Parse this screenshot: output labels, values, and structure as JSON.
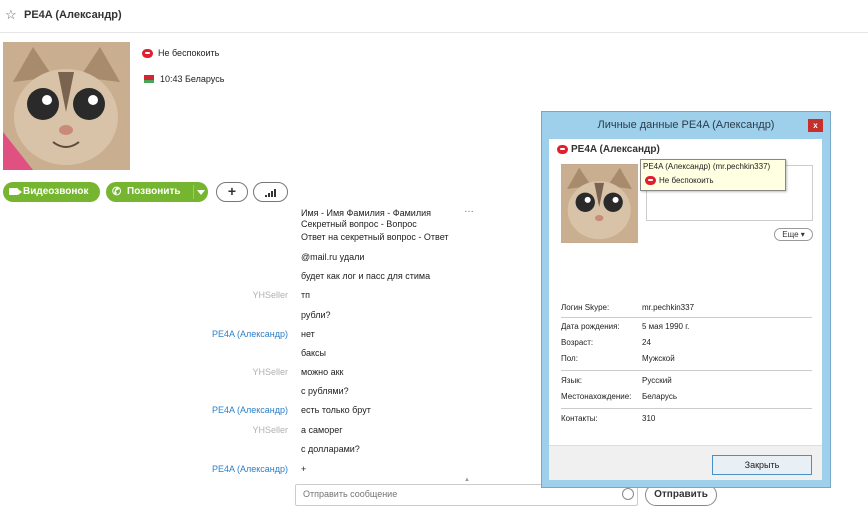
{
  "header": {
    "contact_name": "PE4A (Александр)"
  },
  "profile": {
    "status": "Не беспокоить",
    "local_time": "10:43 Беларусь"
  },
  "actions": {
    "video_call": "Видеозвонок",
    "call": "Позвонить",
    "add": "+"
  },
  "chat": {
    "top_cut_line": "Имя - Имя Фамилия - Фамилия",
    "messages": [
      {
        "sender": "",
        "text": "Секретный вопрос - Вопрос"
      },
      {
        "sender": "",
        "text": "Ответ на секретный вопрос - Ответ"
      },
      {
        "sender": "",
        "text": "@mail.ru удали"
      },
      {
        "sender": "",
        "text": "будет как лог и пасс для стима"
      },
      {
        "sender": "YHSeller",
        "text": "тп"
      },
      {
        "sender": "",
        "text": "рубли?"
      },
      {
        "sender": "PE4A (Александр)",
        "text": "нет"
      },
      {
        "sender": "",
        "text": "баксы"
      },
      {
        "sender": "YHSeller",
        "text": "можно акк"
      },
      {
        "sender": "",
        "text": "с рублями?"
      },
      {
        "sender": "PE4A (Александр)",
        "text": "есть только брут"
      },
      {
        "sender": "YHSeller",
        "text": "а саморег"
      },
      {
        "sender": "",
        "text": "с долларами?"
      },
      {
        "sender": "PE4A (Александр)",
        "text": "+"
      }
    ],
    "input_placeholder": "Отправить сообщение",
    "send_label": "Отправить"
  },
  "dialog": {
    "title": "Личные данные PE4A (Александр)",
    "name": "PE4A (Александр)",
    "tooltip": {
      "line1": "PE4A (Александр) (mr.pechkin337)",
      "line2": "Не беспокоить"
    },
    "more_label": "Еще",
    "info": [
      {
        "label": "Логин Skype:",
        "value": "mr.pechkin337"
      },
      {
        "label": "Дата рождения:",
        "value": "5 мая 1990 г."
      },
      {
        "label": "Возраст:",
        "value": "24"
      },
      {
        "label": "Пол:",
        "value": "Мужской"
      },
      {
        "label": "Язык:",
        "value": "Русский"
      },
      {
        "label": "Местонахождение:",
        "value": "Беларусь"
      },
      {
        "label": "Контакты:",
        "value": "310"
      }
    ],
    "close_label": "Закрыть"
  },
  "colors": {
    "accent_green": "#75b530",
    "link_blue": "#2c80c8",
    "dnd_red": "#e02030",
    "dialog_frame": "#9ed0ec"
  }
}
